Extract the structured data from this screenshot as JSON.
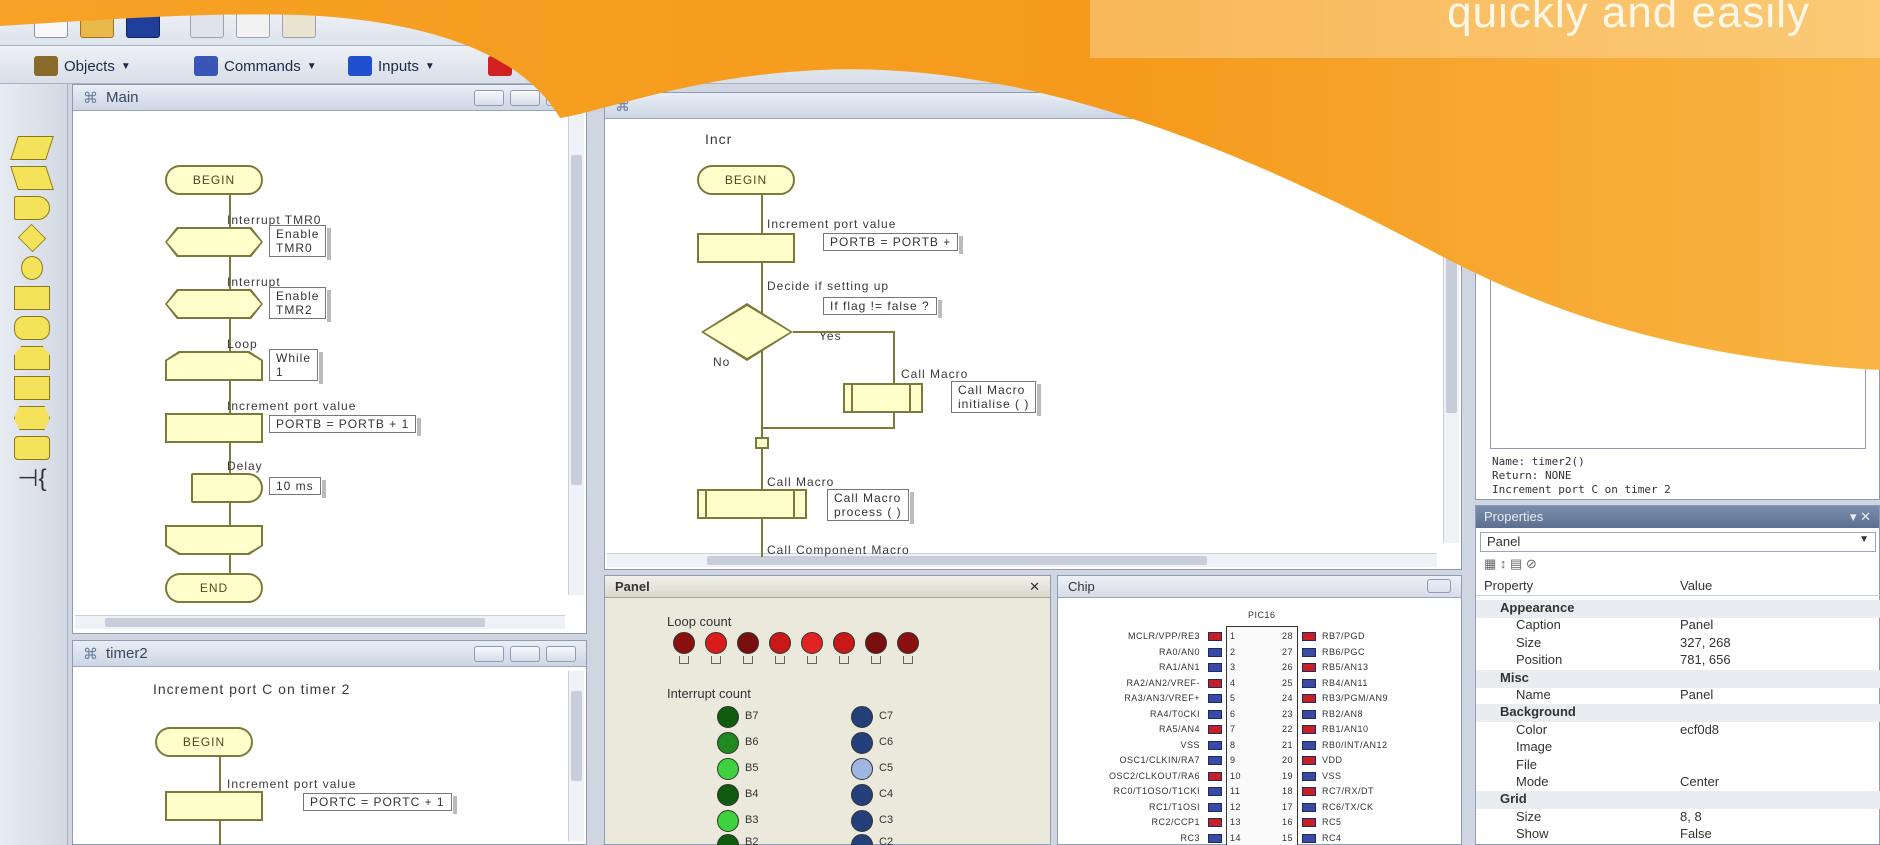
{
  "banner": {
    "text": "quickly and easily"
  },
  "toolbar": {
    "objects_label": "Objects",
    "commands_label": "Commands",
    "inputs_label": "Inputs",
    "icons": [
      "new-file-icon",
      "open-folder-icon",
      "save-icon",
      "cut-icon",
      "copy-icon",
      "paste-icon"
    ]
  },
  "iconbar": {
    "icons": [
      "input-icon",
      "output-icon",
      "delay-icon",
      "decision-icon",
      "connection-point-icon",
      "call-macro-icon",
      "component-macro-icon",
      "loop-icon",
      "calculation-icon",
      "interrupt-icon",
      "string-icon",
      "comment-icon"
    ]
  },
  "main_window": {
    "title": "Main",
    "begin": "BEGIN",
    "end": "END",
    "labels": [
      "Interrupt TMR0",
      "Interrupt",
      "Loop",
      "Increment port value",
      "Delay"
    ],
    "notes": [
      "Enable\nTMR0",
      "Enable\nTMR2",
      "While\n1",
      "PORTB = PORTB + 1",
      "10 ms"
    ]
  },
  "timer_window": {
    "title": "timer2",
    "heading": "Increment port C on timer 2",
    "begin": "BEGIN",
    "label": "Increment port value",
    "note": "PORTC = PORTC + 1"
  },
  "center_window": {
    "title": "",
    "top_text": "Incr",
    "begin": "BEGIN",
    "labels": [
      "Increment port value",
      "Decide if setting up",
      "Yes",
      "No",
      "Call Macro",
      "Call Macro",
      "Call Component Macro"
    ],
    "notes": [
      "PORTB = PORTB +",
      "If flag != false ?",
      "Call Macro\ninitialise ( )",
      "Call Macro\nprocess ( )"
    ]
  },
  "panel": {
    "title": "Panel",
    "loop_count_label": "Loop count",
    "interrupt_count_label": "Interrupt count",
    "left_labels": [
      "B7",
      "B6",
      "B5",
      "B4",
      "B3",
      "B2"
    ],
    "right_labels": [
      "C7",
      "C6",
      "C5",
      "C4",
      "C3",
      "C2"
    ],
    "colors": {
      "red": "#c81818",
      "darkred": "#7a0d0d",
      "green": "#1f8a1f",
      "lightgreen": "#3fd23f",
      "darkgreen": "#0e5a0e",
      "blue": "#23407a",
      "lightblue": "#9fb7e0"
    }
  },
  "chip": {
    "title": "Chip",
    "part": "PIC16",
    "left_pins": [
      "MCLR/VPP/RE3",
      "RA0/AN0",
      "RA1/AN1",
      "RA2/AN2/VREF-",
      "RA3/AN3/VREF+",
      "RA4/T0CKI",
      "RA5/AN4",
      "VSS",
      "OSC1/CLKIN/RA7",
      "OSC2/CLKOUT/RA6",
      "RC0/T1OSO/T1CKI",
      "RC1/T1OSI",
      "RC2/CCP1",
      "RC3"
    ],
    "right_pins": [
      "RB7/PGD",
      "RB6/PGC",
      "RB5/AN13",
      "RB4/AN11",
      "RB3/PGM/AN9",
      "RB2/AN8",
      "RB1/AN10",
      "RB0/INT/AN12",
      "VDD",
      "VSS",
      "RC7/RX/DT",
      "RC6/TX/CK",
      "RC5",
      "RC4"
    ],
    "left_numbers": [
      "1",
      "2",
      "3",
      "4",
      "5",
      "6",
      "7",
      "8",
      "9",
      "10",
      "11",
      "12",
      "13",
      "14"
    ],
    "right_numbers": [
      "28",
      "27",
      "26",
      "25",
      "24",
      "23",
      "22",
      "21",
      "20",
      "19",
      "18",
      "17",
      "16",
      "15"
    ]
  },
  "info_panel": {
    "lines": [
      "Name:    timer2()",
      "Return:  NONE",
      "Increment port C on timer 2"
    ]
  },
  "properties": {
    "header": "Properties",
    "selected": "Panel",
    "col_property": "Property",
    "col_value": "Value",
    "rows": [
      {
        "key": "Appearance",
        "value": "",
        "category": true
      },
      {
        "key": "Caption",
        "value": "Panel",
        "category": false
      },
      {
        "key": "Size",
        "value": "327, 268",
        "category": false
      },
      {
        "key": "Position",
        "value": "781, 656",
        "category": false
      },
      {
        "key": "Misc",
        "value": "",
        "category": true
      },
      {
        "key": "Name",
        "value": "Panel",
        "category": false
      },
      {
        "key": "Background",
        "value": "",
        "category": true
      },
      {
        "key": "Color",
        "value": "ecf0d8",
        "category": false
      },
      {
        "key": "Image",
        "value": "",
        "category": false
      },
      {
        "key": "File",
        "value": "",
        "category": false
      },
      {
        "key": "Mode",
        "value": "Center",
        "category": false
      },
      {
        "key": "Grid",
        "value": "",
        "category": true
      },
      {
        "key": "Size",
        "value": "8, 8",
        "category": false
      },
      {
        "key": "Show",
        "value": "False",
        "category": false
      }
    ]
  }
}
